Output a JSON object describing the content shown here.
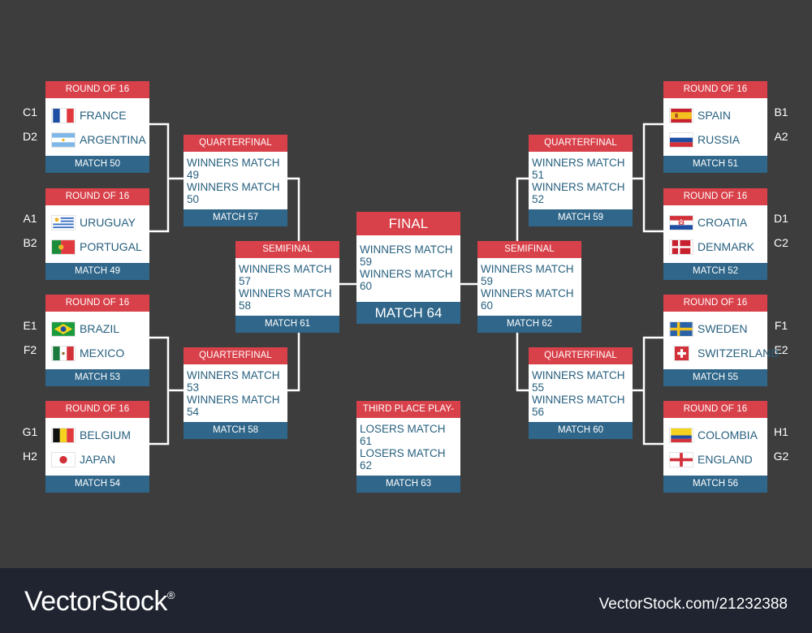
{
  "colors": {
    "background": "#3d3d3d",
    "header_red": "#d8414a",
    "footer_blue": "#2f6689",
    "text_blue": "#27607f",
    "line": "#ffffff",
    "watermark_bar": "#1f2430"
  },
  "round16": [
    {
      "head": "ROUND OF 16",
      "teams": [
        {
          "seed": "C1",
          "name": "FRANCE",
          "flag": "france"
        },
        {
          "seed": "D2",
          "name": "ARGENTINA",
          "flag": "argentina"
        }
      ],
      "foot": "MATCH 50"
    },
    {
      "head": "ROUND OF 16",
      "teams": [
        {
          "seed": "A1",
          "name": "URUGUAY",
          "flag": "uruguay"
        },
        {
          "seed": "B2",
          "name": "PORTUGAL",
          "flag": "portugal"
        }
      ],
      "foot": "MATCH 49"
    },
    {
      "head": "ROUND OF 16",
      "teams": [
        {
          "seed": "E1",
          "name": "BRAZIL",
          "flag": "brazil"
        },
        {
          "seed": "F2",
          "name": "MEXICO",
          "flag": "mexico"
        }
      ],
      "foot": "MATCH 53"
    },
    {
      "head": "ROUND OF 16",
      "teams": [
        {
          "seed": "G1",
          "name": "BELGIUM",
          "flag": "belgium"
        },
        {
          "seed": "H2",
          "name": "JAPAN",
          "flag": "japan"
        }
      ],
      "foot": "MATCH 54"
    },
    {
      "head": "ROUND OF 16",
      "teams": [
        {
          "seed": "B1",
          "name": "SPAIN",
          "flag": "spain"
        },
        {
          "seed": "A2",
          "name": "RUSSIA",
          "flag": "russia"
        }
      ],
      "foot": "MATCH 51"
    },
    {
      "head": "ROUND OF 16",
      "teams": [
        {
          "seed": "D1",
          "name": "CROATIA",
          "flag": "croatia"
        },
        {
          "seed": "C2",
          "name": "DENMARK",
          "flag": "denmark"
        }
      ],
      "foot": "MATCH 52"
    },
    {
      "head": "ROUND OF 16",
      "teams": [
        {
          "seed": "F1",
          "name": "SWEDEN",
          "flag": "sweden"
        },
        {
          "seed": "E2",
          "name": "SWITZERLAND",
          "flag": "switzerland"
        }
      ],
      "foot": "MATCH 55"
    },
    {
      "head": "ROUND OF 16",
      "teams": [
        {
          "seed": "H1",
          "name": "COLOMBIA",
          "flag": "colombia"
        },
        {
          "seed": "G2",
          "name": "ENGLAND",
          "flag": "england"
        }
      ],
      "foot": "MATCH 56"
    }
  ],
  "quarterfinals": [
    {
      "head": "QUARTERFINAL",
      "rows": [
        "WINNERS MATCH 49",
        "WINNERS MATCH 50"
      ],
      "foot": "MATCH 57"
    },
    {
      "head": "QUARTERFINAL",
      "rows": [
        "WINNERS MATCH 53",
        "WINNERS MATCH 54"
      ],
      "foot": "MATCH 58"
    },
    {
      "head": "QUARTERFINAL",
      "rows": [
        "WINNERS MATCH 51",
        "WINNERS MATCH 52"
      ],
      "foot": "MATCH 59"
    },
    {
      "head": "QUARTERFINAL",
      "rows": [
        "WINNERS MATCH 55",
        "WINNERS MATCH 56"
      ],
      "foot": "MATCH 60"
    }
  ],
  "semifinals": [
    {
      "head": "SEMIFINAL",
      "rows": [
        "WINNERS MATCH 57",
        "WINNERS MATCH 58"
      ],
      "foot": "MATCH 61"
    },
    {
      "head": "SEMIFINAL",
      "rows": [
        "WINNERS MATCH 59",
        "WINNERS MATCH 60"
      ],
      "foot": "MATCH 62"
    }
  ],
  "final": {
    "head": "FINAL",
    "rows": [
      "WINNERS MATCH 59",
      "WINNERS MATCH 60"
    ],
    "foot": "MATCH 64"
  },
  "third_place": {
    "head": "THIRD PLACE PLAY-OFF",
    "rows": [
      "LOSERS MATCH 61",
      "LOSERS MATCH 62"
    ],
    "foot": "MATCH 63"
  },
  "watermark": {
    "logo": "VectorStock",
    "registered": "®",
    "id": "VectorStock.com/21232388"
  }
}
